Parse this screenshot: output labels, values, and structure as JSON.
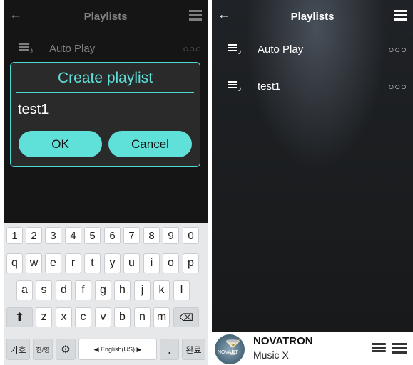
{
  "left": {
    "topbar": {
      "back_icon": "arrow-left-icon",
      "title": "Playlists",
      "menu_icon": "list-icon"
    },
    "row": {
      "label": "Auto Play",
      "more": "○○○"
    },
    "dialog": {
      "title": "Create playlist",
      "input_value": "test1",
      "ok_label": "OK",
      "cancel_label": "Cancel"
    },
    "keyboard": {
      "numbers": [
        "1",
        "2",
        "3",
        "4",
        "5",
        "6",
        "7",
        "8",
        "9",
        "0"
      ],
      "row1": [
        "q",
        "w",
        "e",
        "r",
        "t",
        "y",
        "u",
        "i",
        "o",
        "p"
      ],
      "row2": [
        "a",
        "s",
        "d",
        "f",
        "g",
        "h",
        "j",
        "k",
        "l"
      ],
      "row3": [
        "z",
        "x",
        "c",
        "v",
        "b",
        "n",
        "m"
      ],
      "shift_icon": "shift-arrow-icon",
      "backspace_icon": "backspace-icon",
      "symbols_label": "기호",
      "lang_toggle": "한/영",
      "settings_icon": "gear-icon",
      "space_label": "◀ English(US) ▶",
      "period_label": ".",
      "period_alt": ",?",
      "done_label": "완료"
    }
  },
  "right": {
    "topbar": {
      "back_icon": "arrow-left-icon",
      "title": "Playlists",
      "menu_icon": "list-icon"
    },
    "playlists": [
      {
        "label": "Auto Play",
        "more": "○○○"
      },
      {
        "label": "test1",
        "more": "○○○"
      }
    ],
    "player": {
      "album_art_text": "NOVART",
      "title": "NOVATRON",
      "subtitle": "Music X",
      "library_icon": "library-icon",
      "list_icon": "list-icon"
    }
  },
  "colors": {
    "accent": "#5fe0d8",
    "dialog_bg": "#2a2a2a",
    "bg": "#151515"
  }
}
